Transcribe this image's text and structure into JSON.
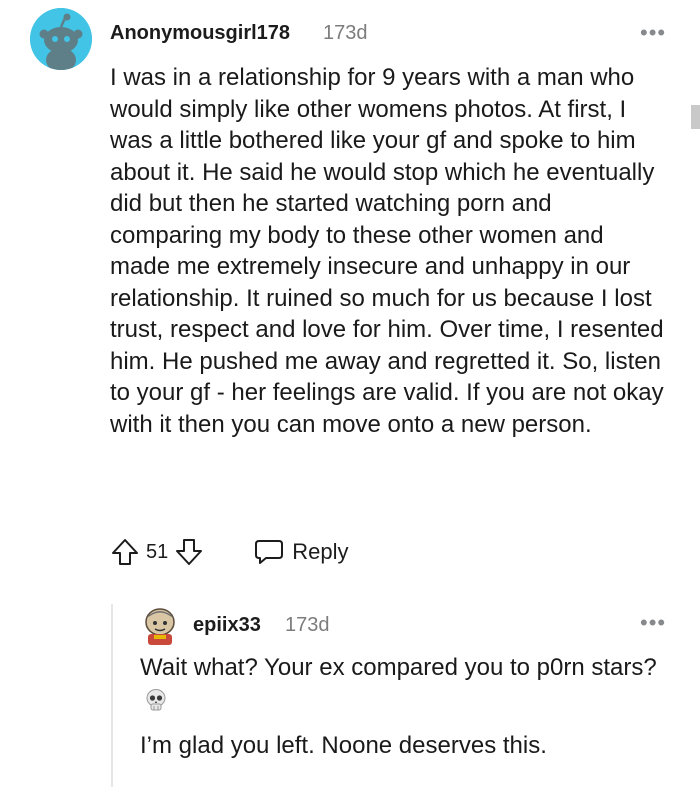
{
  "comment": {
    "username": "Anonymousgirl178",
    "age": "173d",
    "menu_icon": "more-horizontal-icon",
    "body": "I was in a relationship for 9 years with a man who would simply like other womens photos. At first, I was a little bothered like your gf and spoke to him about it. He said he would stop which he eventually did but then he started watching porn and comparing my body to these other women and made me extremely insecure and unhappy in our relationship. It ruined so much for us because I lost trust, respect and love for him. Over time, I resented him. He pushed me away and regretted it. So, listen to your gf - her feelings are valid. If you are not okay with it then you can move onto a new person.",
    "score": "51",
    "reply_label": "Reply",
    "upvote_icon": "upvote-arrow-icon",
    "downvote_icon": "downvote-arrow-icon",
    "reply_icon": "speech-bubble-icon"
  },
  "reply": {
    "username": "epiix33",
    "age": "173d",
    "paragraph1": "Wait what? Your ex compared you to p0rn stars?",
    "emoji": "skull-emoji-icon",
    "paragraph2": "I’m glad you left. Noone deserves this."
  },
  "colors": {
    "avatar_bg": "#41c4e6",
    "meta_gray": "#7c7c7c",
    "text": "#1a1a1b",
    "thread_line": "#e6e6e6"
  }
}
